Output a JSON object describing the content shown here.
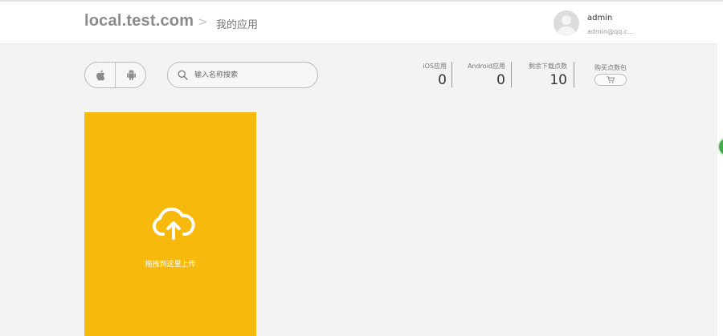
{
  "header": {
    "site_title": "local.test.com",
    "breadcrumb_separator": ">",
    "breadcrumb": "我的应用",
    "user": {
      "name": "admin",
      "email": "admin@qq.c..."
    }
  },
  "toolbar": {
    "platform_icons": [
      "apple-icon",
      "android-icon"
    ],
    "search": {
      "icon": "search-icon",
      "placeholder": "输入名称搜索",
      "value": ""
    },
    "stats": [
      {
        "label": "iOS应用",
        "value": "0"
      },
      {
        "label": "Android应用",
        "value": "0"
      },
      {
        "label": "剩余下载点数",
        "value": "10"
      }
    ],
    "buy": {
      "label": "购买点数包",
      "icon": "cart-icon"
    }
  },
  "upload_card": {
    "icon": "cloud-upload-icon",
    "hint": "拖拽到这里上传",
    "color": "#f7b90b"
  }
}
